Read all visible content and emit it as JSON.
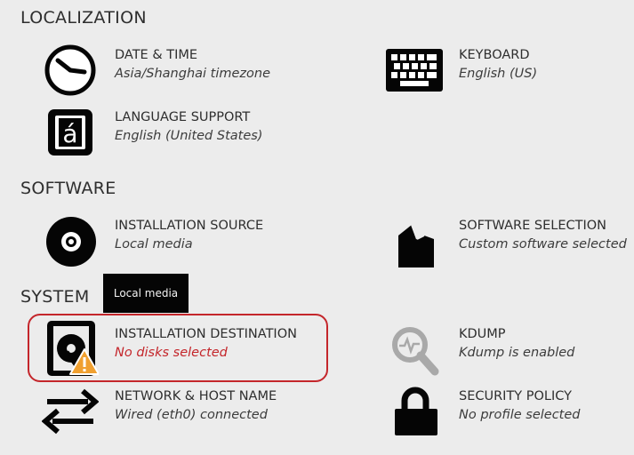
{
  "sections": {
    "localization": "LOCALIZATION",
    "software": "SOFTWARE",
    "system": "SYSTEM"
  },
  "spokes": {
    "date_time": {
      "title": "DATE & TIME",
      "status": "Asia/Shanghai timezone",
      "icon": "clock-icon"
    },
    "keyboard": {
      "title": "KEYBOARD",
      "status": "English (US)",
      "icon": "keyboard-icon"
    },
    "language_support": {
      "title": "LANGUAGE SUPPORT",
      "status": "English (United States)",
      "icon": "language-icon"
    },
    "installation_source": {
      "title": "INSTALLATION SOURCE",
      "status": "Local media",
      "icon": "disc-icon"
    },
    "software_selection": {
      "title": "SOFTWARE SELECTION",
      "status": "Custom software selected",
      "icon": "package-icon"
    },
    "installation_destination": {
      "title": "INSTALLATION DESTINATION",
      "status": "No disks selected",
      "icon": "hard-disk-icon",
      "warning": true
    },
    "kdump": {
      "title": "KDUMP",
      "status": "Kdump is enabled",
      "icon": "magnifier-icon"
    },
    "network_host": {
      "title": "NETWORK & HOST NAME",
      "status": "Wired (eth0) connected",
      "icon": "network-arrows-icon"
    },
    "security_policy": {
      "title": "SECURITY POLICY",
      "status": "No profile selected",
      "icon": "padlock-icon"
    }
  },
  "tooltip": {
    "text": "Local media"
  },
  "colors": {
    "background": "#ececec",
    "text": "#2e2e2e",
    "warning": "#c4262b",
    "warning_icon": "#f0a030",
    "tooltip_bg": "#050505"
  }
}
